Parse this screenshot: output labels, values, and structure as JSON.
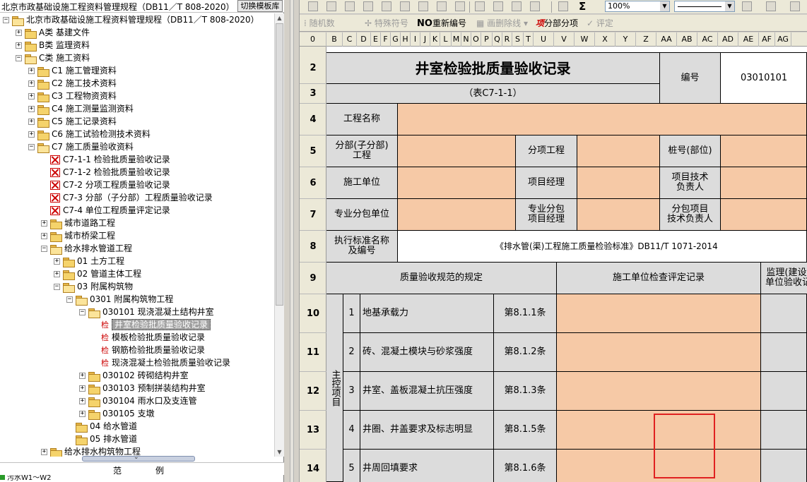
{
  "left_pane": {
    "title": "北京市政基础设施工程资料管理规程（DB11／T 808-2020）",
    "switch_button": "切换模板库",
    "tree": [
      {
        "label": "北京市政基础设施工程资料管理规程（DB11／T 808-2020）",
        "level": 0,
        "expander": "−",
        "icon": "folder-open"
      },
      {
        "label": "A类 基建文件",
        "level": 1,
        "expander": "+",
        "icon": "folder"
      },
      {
        "label": "B类 监理资料",
        "level": 1,
        "expander": "+",
        "icon": "folder"
      },
      {
        "label": "C类 施工资料",
        "level": 1,
        "expander": "−",
        "icon": "folder-open"
      },
      {
        "label": "C1 施工管理资料",
        "level": 2,
        "expander": "+",
        "icon": "folder"
      },
      {
        "label": "C2 施工技术资料",
        "level": 2,
        "expander": "+",
        "icon": "folder"
      },
      {
        "label": "C3 工程物资资料",
        "level": 2,
        "expander": "+",
        "icon": "folder"
      },
      {
        "label": "C4 施工测量监测资料",
        "level": 2,
        "expander": "+",
        "icon": "folder"
      },
      {
        "label": "C5 施工记录资料",
        "level": 2,
        "expander": "+",
        "icon": "folder"
      },
      {
        "label": "C6 施工试验检测技术资料",
        "level": 2,
        "expander": "+",
        "icon": "folder"
      },
      {
        "label": "C7 施工质量验收资料",
        "level": 2,
        "expander": "−",
        "icon": "folder-open"
      },
      {
        "label": "C7-1-1 检验批质量验收记录",
        "level": 3,
        "expander": "",
        "icon": "x"
      },
      {
        "label": "C7-1-2 检验批质量验收记录",
        "level": 3,
        "expander": "",
        "icon": "x"
      },
      {
        "label": "C7-2 分项工程质量验收记录",
        "level": 3,
        "expander": "",
        "icon": "x"
      },
      {
        "label": "C7-3 分部（子分部）工程质量验收记录",
        "level": 3,
        "expander": "",
        "icon": "x"
      },
      {
        "label": "C7-4 单位工程质量评定记录",
        "level": 3,
        "expander": "",
        "icon": "x"
      },
      {
        "label": "城市道路工程",
        "level": 3,
        "expander": "+",
        "icon": "folder"
      },
      {
        "label": "城市桥梁工程",
        "level": 3,
        "expander": "+",
        "icon": "folder"
      },
      {
        "label": "给水排水管道工程",
        "level": 3,
        "expander": "−",
        "icon": "folder-open"
      },
      {
        "label": "01 土方工程",
        "level": 4,
        "expander": "+",
        "icon": "folder"
      },
      {
        "label": "02 管道主体工程",
        "level": 4,
        "expander": "+",
        "icon": "folder"
      },
      {
        "label": "03 附属构筑物",
        "level": 4,
        "expander": "−",
        "icon": "folder-open"
      },
      {
        "label": "0301 附属构筑物工程",
        "level": 5,
        "expander": "−",
        "icon": "folder-open"
      },
      {
        "label": "030101 现浇混凝土结构井室",
        "level": 6,
        "expander": "−",
        "icon": "folder-open"
      },
      {
        "label": "井室检验批质量验收记录",
        "level": 7,
        "expander": "",
        "icon": "jian",
        "selected": true
      },
      {
        "label": "模板检验批质量验收记录",
        "level": 7,
        "expander": "",
        "icon": "jian"
      },
      {
        "label": "钢筋检验批质量验收记录",
        "level": 7,
        "expander": "",
        "icon": "jian"
      },
      {
        "label": "现浇混凝土检验批质量验收记录",
        "level": 7,
        "expander": "",
        "icon": "jian"
      },
      {
        "label": "030102 砖砌结构井室",
        "level": 6,
        "expander": "+",
        "icon": "folder"
      },
      {
        "label": "030103 预制拼装结构井室",
        "level": 6,
        "expander": "+",
        "icon": "folder"
      },
      {
        "label": "030104 雨水口及支连管",
        "level": 6,
        "expander": "+",
        "icon": "folder"
      },
      {
        "label": "030105 支墩",
        "level": 6,
        "expander": "+",
        "icon": "folder"
      },
      {
        "label": "04 给水管道",
        "level": 5,
        "expander": "",
        "icon": "folder"
      },
      {
        "label": "05 排水管道",
        "level": 5,
        "expander": "",
        "icon": "folder"
      },
      {
        "label": "给水排水构筑物工程",
        "level": 3,
        "expander": "+",
        "icon": "folder"
      }
    ],
    "jian_glyph": "检",
    "legend_label_1": "范",
    "legend_label_2": "例",
    "legend_item": "污水W1～W2"
  },
  "toolbar2": {
    "random": "随机数",
    "special": "特殊符号",
    "no_glyph": "NO",
    "renumber": "重新编号",
    "delete_line": "画删除线",
    "xiang_glyph": "项",
    "section": "分部分项",
    "evaluate": "评定"
  },
  "toolbar1": {
    "sigma": "Σ",
    "zoom": "100%"
  },
  "columns": [
    "0",
    "B",
    "C",
    "D",
    "E",
    "F",
    "G",
    "H",
    "I",
    "J",
    "K",
    "L",
    "M",
    "N",
    "O",
    "P",
    "Q",
    "R",
    "S",
    "T",
    "U",
    "V",
    "W",
    "X",
    "Y",
    "Z",
    "AA",
    "AB",
    "AC",
    "AD",
    "AE",
    "AF",
    "AG"
  ],
  "rows": [
    "2",
    "3",
    "4",
    "5",
    "6",
    "7",
    "8",
    "9",
    "10",
    "11",
    "12",
    "13",
    "14"
  ],
  "form": {
    "title": "井室检验批质量验收记录",
    "subtitle": "（表C7-1-1）",
    "code_label": "编号",
    "code_value": "03010101",
    "project_name": "工程名称",
    "subdivision": "分部(子分部)\n工程",
    "sub_item": "分项工程",
    "pile_no": "桩号(部位)",
    "contractor": "施工单位",
    "pm": "项目经理",
    "tech_lead": "项目技术\n负责人",
    "sub_contractor": "专业分包单位",
    "sub_pm": "专业分包\n项目经理",
    "sub_tech": "分包项目\n技术负责人",
    "standard_label": "执行标准名称\n及编号",
    "standard_value": "《排水管(渠)工程施工质量检验标准》DB11/T 1071-2014",
    "spec_header": "质量验收规范的规定",
    "record_header": "施工单位检查评定记录",
    "supervisor_header": "监理(建设)\n单位验收记",
    "main_items": "主控项目",
    "items": [
      {
        "no": "1",
        "text": "地基承载力",
        "clause": "第8.1.1条"
      },
      {
        "no": "2",
        "text": "砖、混凝土模块与砂浆强度",
        "clause": "第8.1.2条"
      },
      {
        "no": "3",
        "text": "井室、盖板混凝土抗压强度",
        "clause": "第8.1.3条"
      },
      {
        "no": "4",
        "text": "井圈、井盖要求及标志明显",
        "clause": "第8.1.5条"
      },
      {
        "no": "5",
        "text": "井周回填要求",
        "clause": "第8.1.6条"
      }
    ]
  },
  "colors": {
    "peach": "#f6c9a6",
    "gray": "#dcdcdc",
    "highlight_box": "#e02020"
  }
}
